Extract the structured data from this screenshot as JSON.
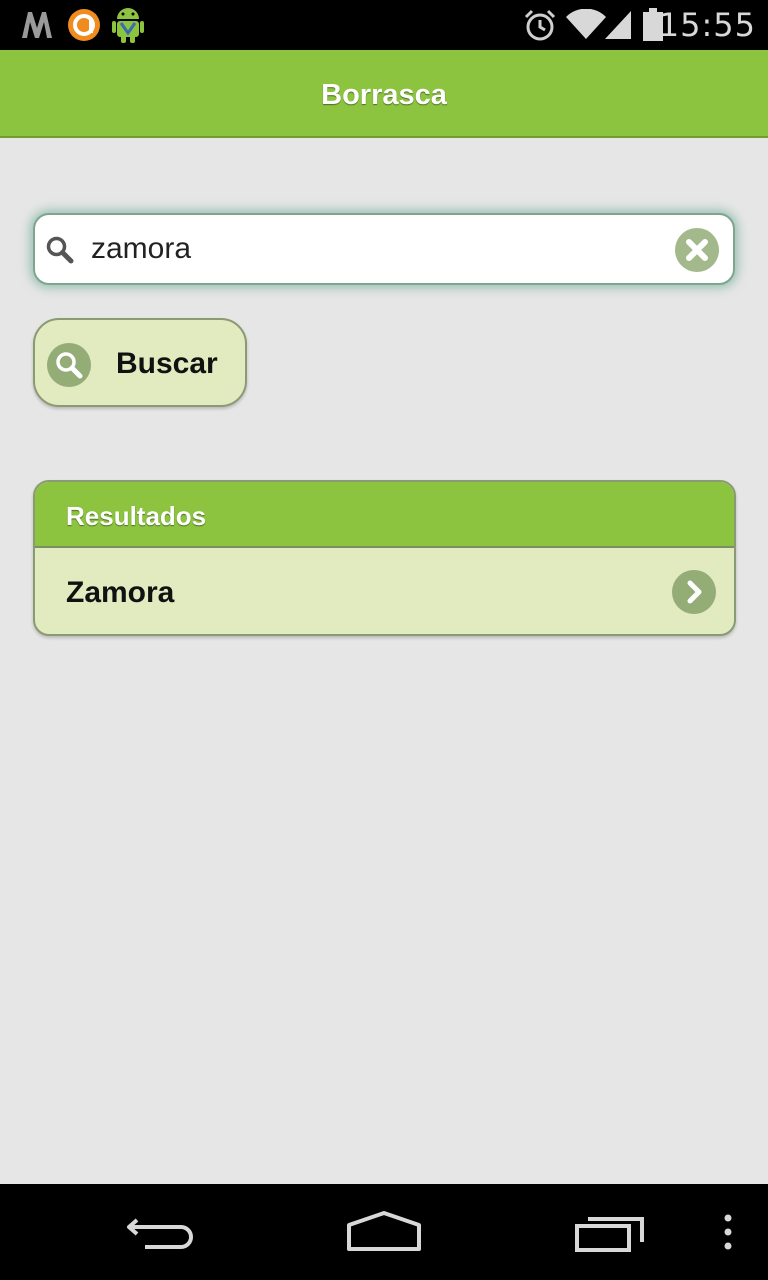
{
  "status_bar": {
    "time": "15:55",
    "notification_icons": [
      "m-app-icon",
      "orange-a-app-icon",
      "android-debug-icon"
    ],
    "system_icons": [
      "alarm-icon",
      "wifi-icon",
      "signal-icon",
      "battery-icon"
    ]
  },
  "header": {
    "title": "Borrasca"
  },
  "search": {
    "value": "zamora",
    "icon": "search-icon",
    "clear_icon": "clear-icon"
  },
  "buscar_button": {
    "label": "Buscar",
    "icon": "search-icon"
  },
  "results": {
    "title": "Resultados",
    "items": [
      {
        "label": "Zamora",
        "icon": "chevron-right-icon"
      }
    ]
  },
  "nav_bar": {
    "buttons": [
      "back-icon",
      "home-icon",
      "recent-apps-icon",
      "overflow-menu-icon"
    ]
  },
  "colors": {
    "accent_green": "#8cc43f",
    "light_green": "#e2eac0",
    "icon_green": "#94ac76",
    "background": "#e6e6e6"
  }
}
